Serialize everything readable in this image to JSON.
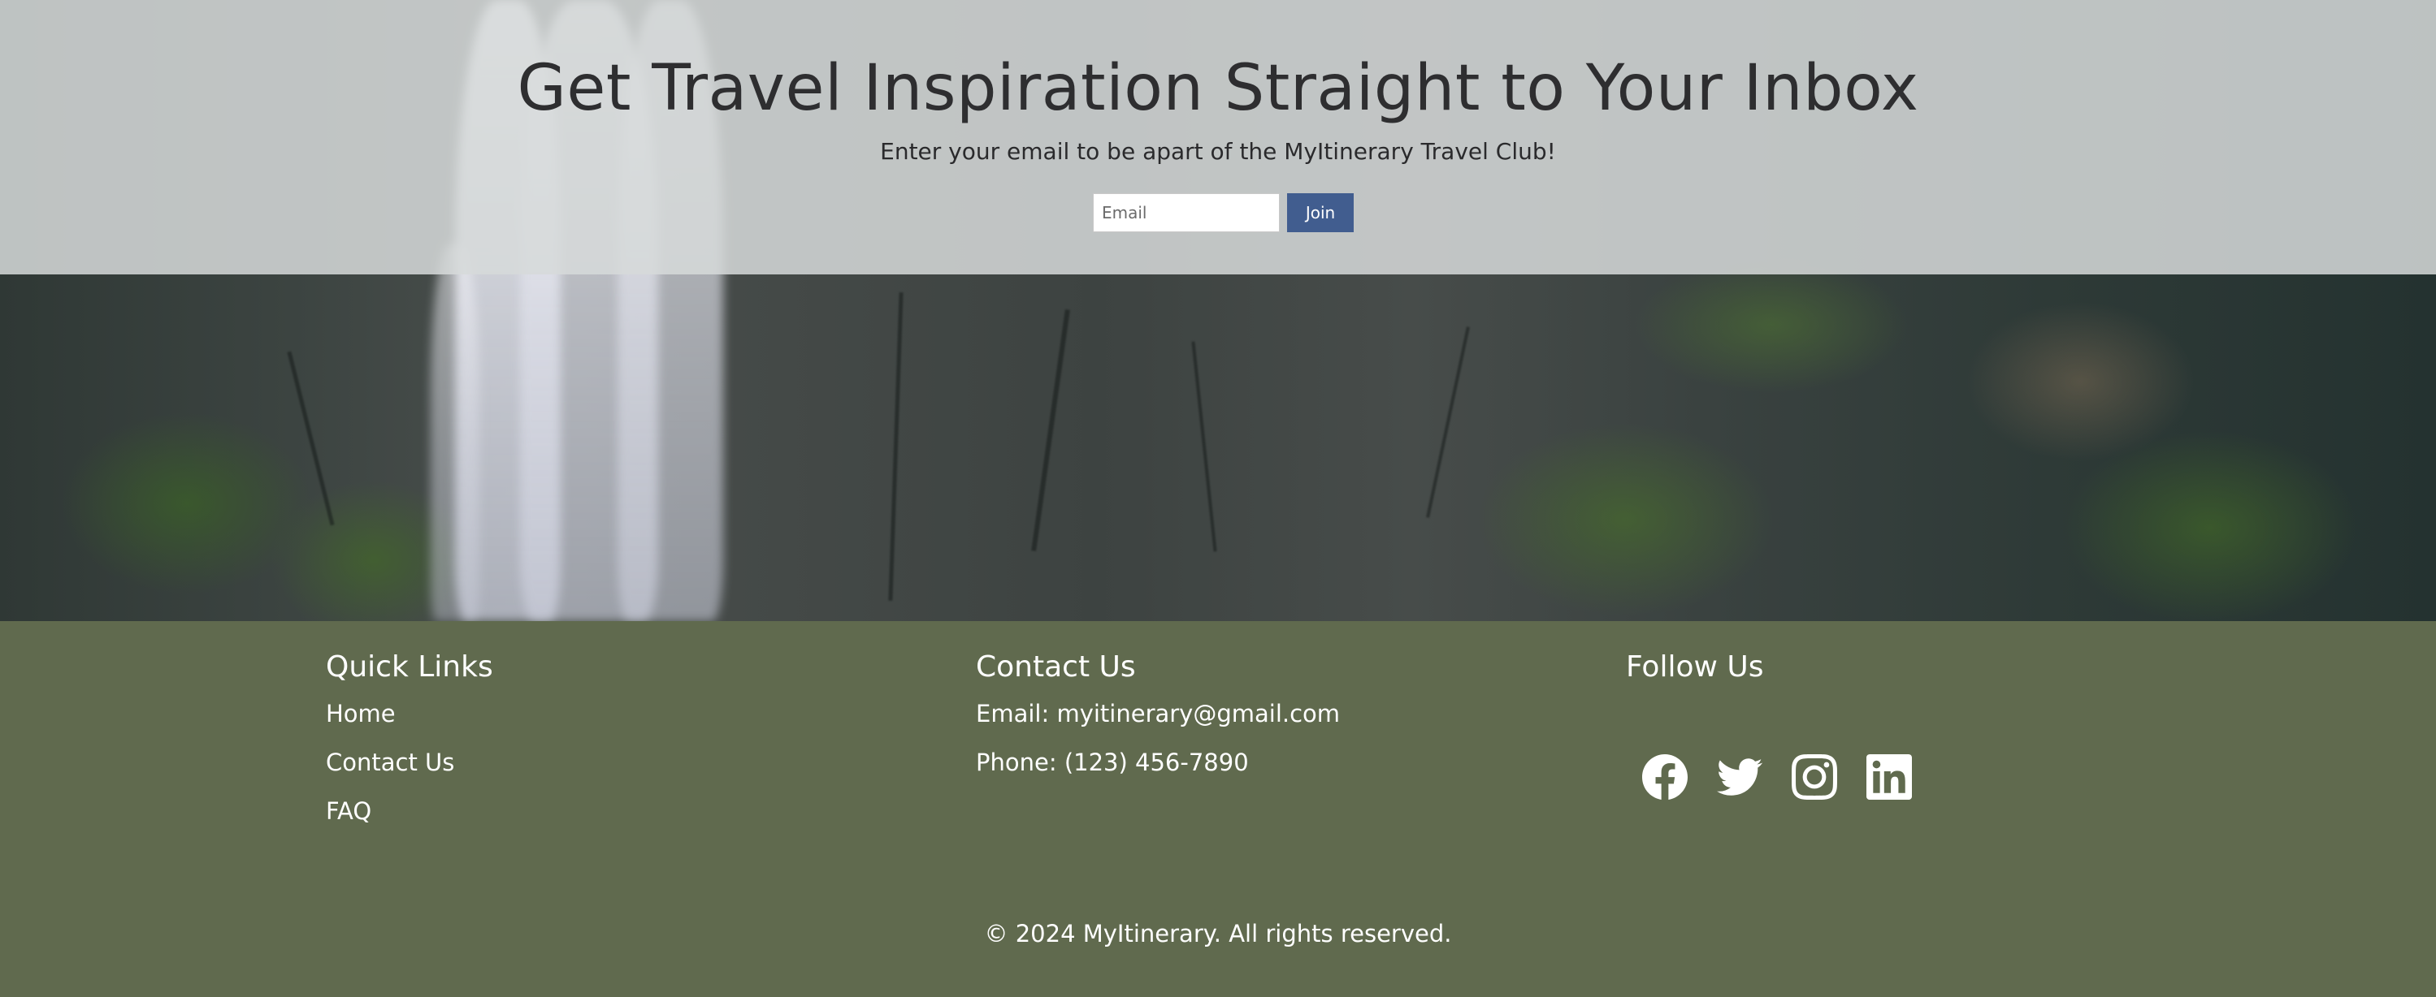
{
  "newsletter": {
    "title": "Get Travel Inspiration Straight to Your Inbox",
    "subtitle": "Enter your email to be apart of the MyItinerary Travel Club!",
    "email_placeholder": "Email",
    "join_label": "Join",
    "join_button_color": "#415d8f"
  },
  "footer": {
    "background_color": "#606a4e",
    "quick_links": {
      "heading": "Quick Links",
      "items": [
        "Home",
        "Contact Us",
        "FAQ"
      ]
    },
    "contact": {
      "heading": "Contact Us",
      "email": "Email: myitinerary@gmail.com",
      "phone": "Phone: (123) 456-7890"
    },
    "follow": {
      "heading": "Follow Us",
      "icons": [
        "facebook-icon",
        "twitter-icon",
        "instagram-icon",
        "linkedin-icon"
      ]
    },
    "copyright": "© 2024 MyItinerary. All rights reserved."
  }
}
